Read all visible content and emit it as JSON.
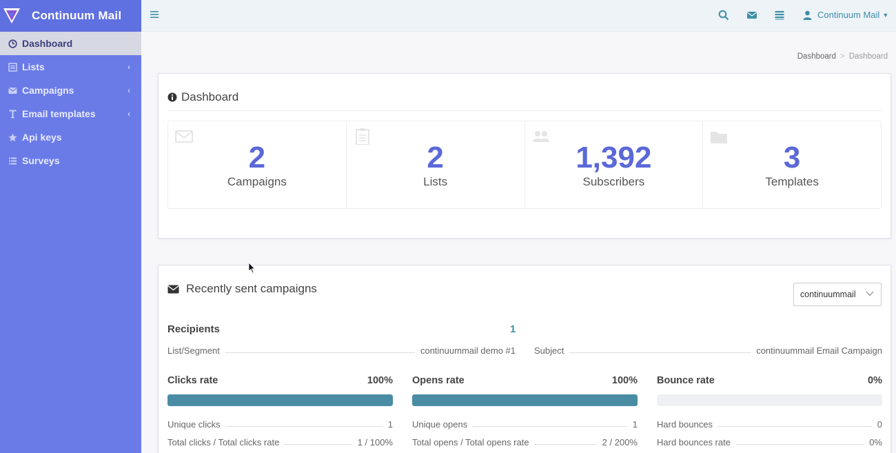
{
  "brand": {
    "name": "Continuum Mail"
  },
  "sidebar": {
    "items": [
      {
        "label": "Dashboard",
        "icon": "dashboard-icon",
        "active": true
      },
      {
        "label": "Lists",
        "icon": "list-icon"
      },
      {
        "label": "Campaigns",
        "icon": "envelope-icon"
      },
      {
        "label": "Email templates",
        "icon": "text-icon"
      },
      {
        "label": "Api keys",
        "icon": "star-icon"
      },
      {
        "label": "Surveys",
        "icon": "list-icon"
      }
    ]
  },
  "topbar": {
    "user_label": "Continuum Mail"
  },
  "breadcrumb": {
    "home": "Dashboard",
    "current": "Dashboard"
  },
  "dashboard": {
    "title": "Dashboard",
    "stats": [
      {
        "value": "2",
        "label": "Campaigns",
        "icon": "envelope-icon"
      },
      {
        "value": "2",
        "label": "Lists",
        "icon": "clipboard-icon"
      },
      {
        "value": "1,392",
        "label": "Subscribers",
        "icon": "users-icon"
      },
      {
        "value": "3",
        "label": "Templates",
        "icon": "folder-icon"
      }
    ]
  },
  "campaigns": {
    "title": "Recently sent campaigns",
    "selected": "continuummail",
    "recipients_label": "Recipients",
    "recipients_value": "1",
    "list_label": "List/Segment",
    "list_value": "continuummail demo #1",
    "subject_label": "Subject",
    "subject_value": "continuummail Email Campaign",
    "clicks": {
      "title": "Clicks rate",
      "rate": "100%",
      "fill": 1.0,
      "unique_label": "Unique clicks",
      "unique_value": "1",
      "total_label": "Total clicks / Total clicks rate",
      "total_value": "1 / 100%"
    },
    "opens": {
      "title": "Opens rate",
      "rate": "100%",
      "fill": 1.0,
      "unique_label": "Unique opens",
      "unique_value": "1",
      "total_label": "Total opens / Total opens rate",
      "total_value": "2 / 200%"
    },
    "bounce": {
      "title": "Bounce rate",
      "rate": "0%",
      "fill": 0.0,
      "hard_label": "Hard bounces",
      "hard_value": "0",
      "hard_rate_label": "Hard bounces rate",
      "hard_rate_value": "0%"
    }
  },
  "colors": {
    "sidebar": "#6a7be8",
    "accent": "#5b68d8",
    "bar": "#4a8ca3",
    "link": "#3e8fa5"
  }
}
